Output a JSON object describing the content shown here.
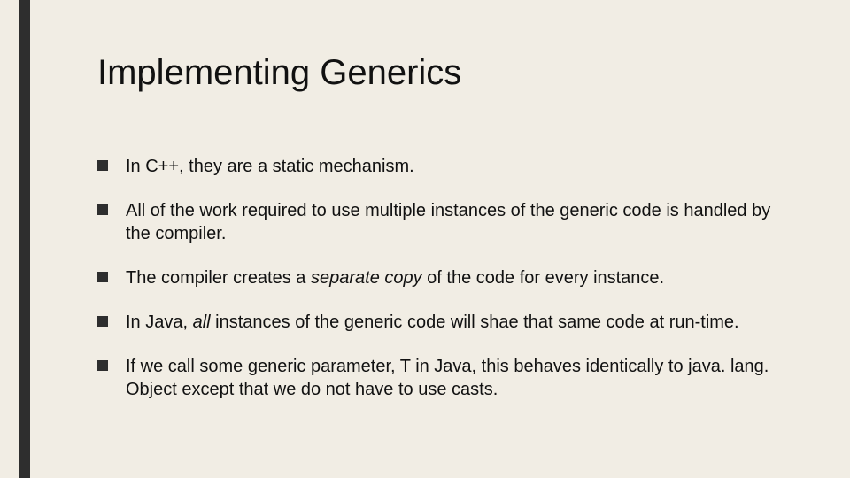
{
  "slide": {
    "title": "Implementing Generics",
    "bullets": [
      {
        "text": "In C++, they are a static mechanism."
      },
      {
        "text": "All of the work required to use multiple instances of the generic code is handled by the compiler."
      },
      {
        "prefix": "The compiler creates a ",
        "italic": "separate copy",
        "suffix": " of the code for every instance."
      },
      {
        "prefix": "In Java, ",
        "italic": "all",
        "suffix": " instances of the generic code will shae that same code at run-time."
      },
      {
        "text": "If we call some generic parameter, T in Java, this behaves identically to java. lang. Object except that we do not have to use casts."
      }
    ]
  }
}
